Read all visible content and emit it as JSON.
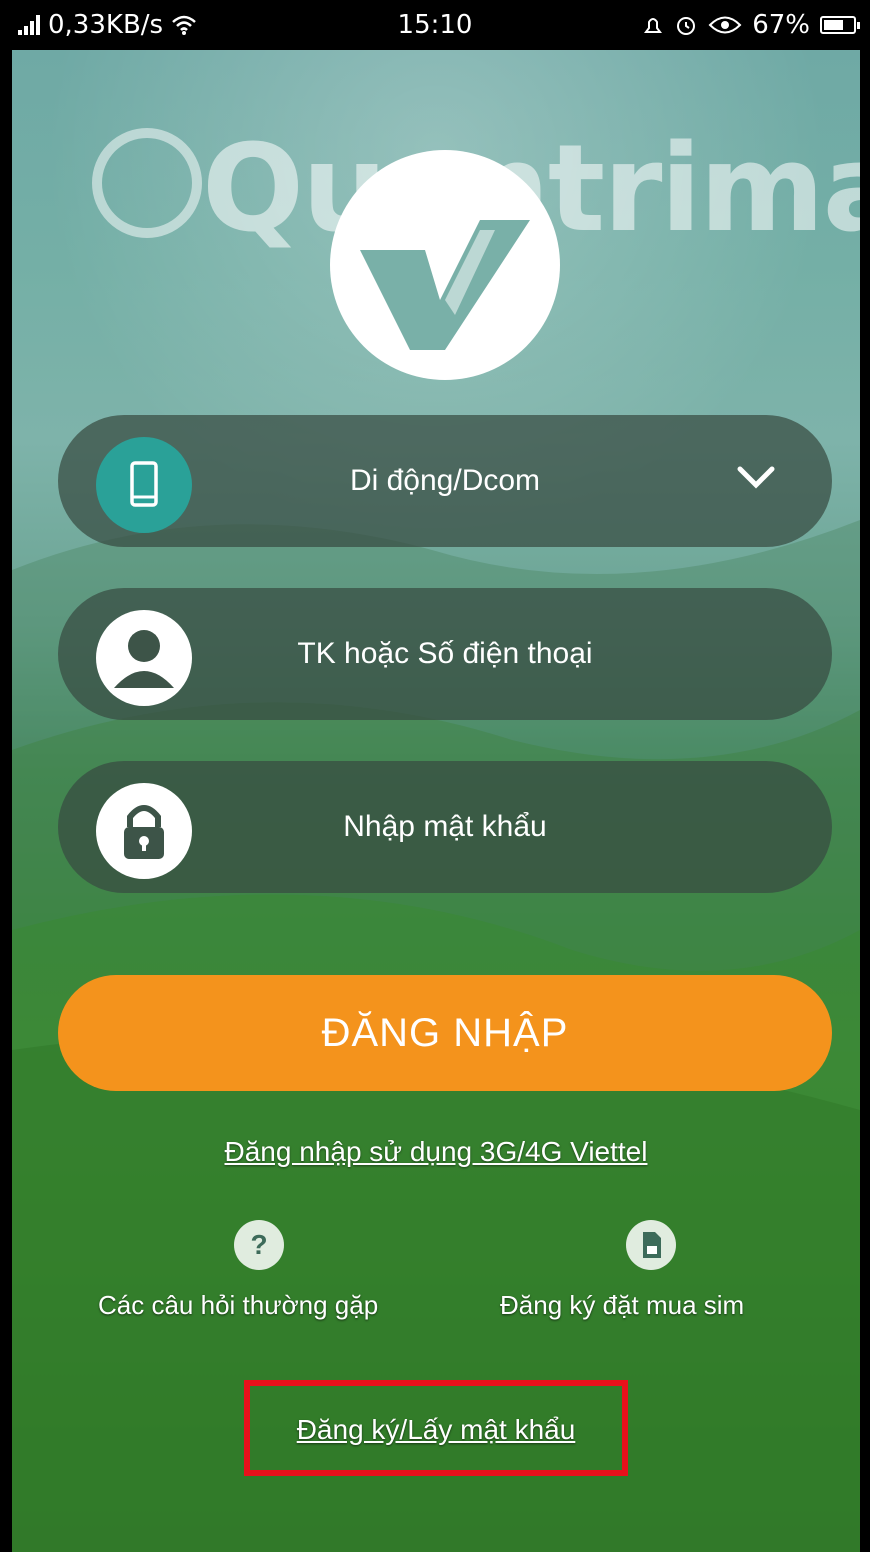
{
  "status_bar": {
    "network_speed": "0,33KB/s",
    "time": "15:10",
    "battery": "67%",
    "battery_level": 0.67
  },
  "watermark": {
    "text": "Quantrimang"
  },
  "login_form": {
    "account_type": {
      "value": "Di động/Dcom"
    },
    "username": {
      "placeholder": "TK hoặc Số điện thoại"
    },
    "password": {
      "placeholder": "Nhập mật khẩu"
    },
    "login_button": "ĐĂNG NHẬP",
    "login_3g_link": "Đăng nhập sử dụng 3G/4G Viettel"
  },
  "shortcuts": [
    {
      "label": "Các câu hỏi thường gặp",
      "icon": "question-icon"
    },
    {
      "label": "Đăng ký đặt mua sim",
      "icon": "sim-card-icon"
    }
  ],
  "register_link": "Đăng ký/Lấy mật khẩu",
  "colors": {
    "accent_orange": "#f4931c",
    "teal": "#2aa198",
    "highlight_red": "#e8111b"
  }
}
